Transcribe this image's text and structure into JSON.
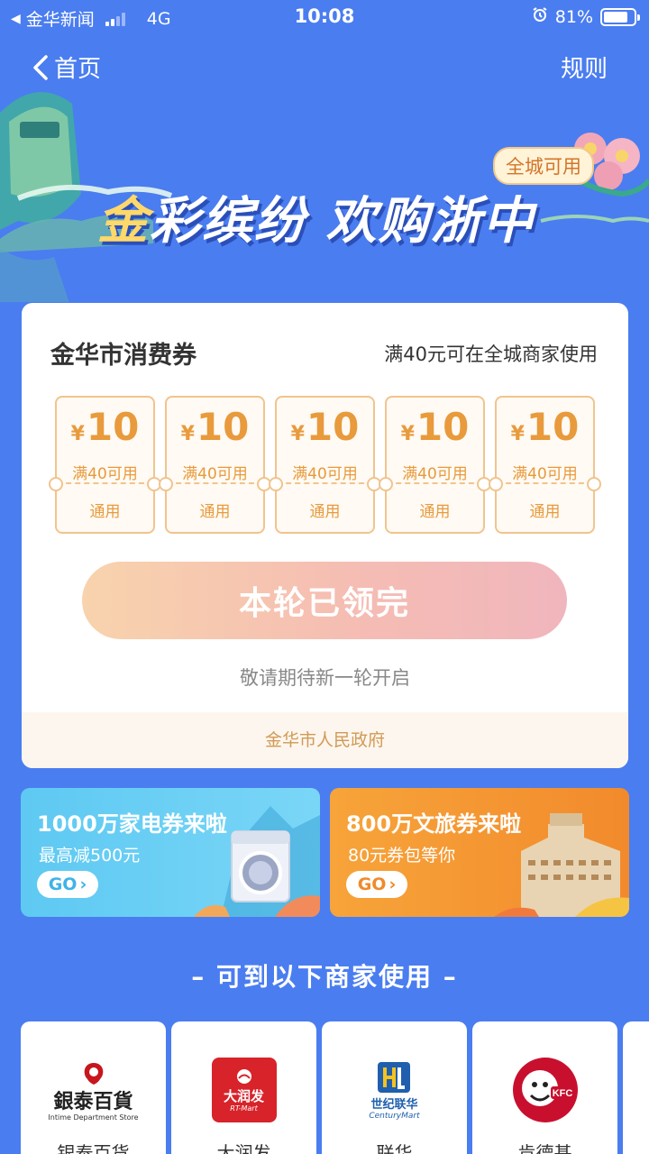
{
  "status_bar": {
    "carrier": "金华新闻",
    "network": "4G",
    "time": "10:08",
    "battery": "81%",
    "battery_level": 0.81
  },
  "nav": {
    "back_label": "首页",
    "rules_label": "规则"
  },
  "banner": {
    "title_gold": "金",
    "title_rest": "彩缤纷 欢购浙中",
    "badge": "全城可用"
  },
  "card": {
    "title": "金华市消费券",
    "note": "满40元可在全城商家使用",
    "coupons": [
      {
        "currency": "¥",
        "amount": "10",
        "condition": "满40可用",
        "type": "通用"
      },
      {
        "currency": "¥",
        "amount": "10",
        "condition": "满40可用",
        "type": "通用"
      },
      {
        "currency": "¥",
        "amount": "10",
        "condition": "满40可用",
        "type": "通用"
      },
      {
        "currency": "¥",
        "amount": "10",
        "condition": "满40可用",
        "type": "通用"
      },
      {
        "currency": "¥",
        "amount": "10",
        "condition": "满40可用",
        "type": "通用"
      }
    ],
    "claim_button": "本轮已领完",
    "claim_sub": "敬请期待新一轮开启",
    "footer": "金华市人民政府"
  },
  "promos": [
    {
      "title": "1000万家电券来啦",
      "sub": "最高减500元",
      "go": "GO"
    },
    {
      "title": "800万文旅券来啦",
      "sub": "80元券包等你",
      "go": "GO"
    }
  ],
  "merchants_section": {
    "title": "– 可到以下商家使用 –",
    "items": [
      {
        "name": "银泰百货",
        "logo_text": "銀泰百貨",
        "logo_sub": "Intime Department Store"
      },
      {
        "name": "大润发",
        "logo_text": "大润发",
        "logo_sub": "RT-Mart"
      },
      {
        "name": "联华",
        "logo_text": "世纪联华",
        "logo_sub": "CenturyMart"
      },
      {
        "name": "肯德基",
        "logo_text": "KFC",
        "logo_sub": ""
      }
    ]
  },
  "colors": {
    "background": "#4a7df0",
    "coupon_accent": "#e89a3c",
    "footer_text": "#d29a55"
  }
}
